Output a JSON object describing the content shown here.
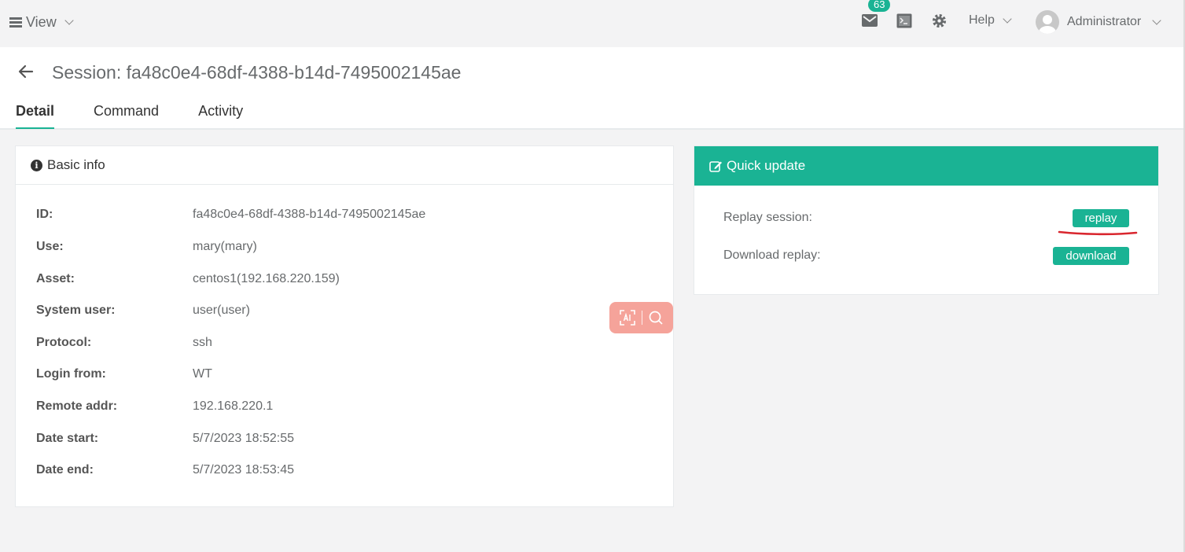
{
  "topbar": {
    "view_label": "View",
    "mail_count": "63",
    "help_label": "Help",
    "user_name": "Administrator"
  },
  "page": {
    "title": "Session: fa48c0e4-68df-4388-b14d-7495002145ae",
    "tabs": [
      {
        "label": "Detail",
        "active": true
      },
      {
        "label": "Command",
        "active": false
      },
      {
        "label": "Activity",
        "active": false
      }
    ]
  },
  "basic_info": {
    "heading": "Basic info",
    "rows": [
      {
        "label": "ID:",
        "value": "fa48c0e4-68df-4388-b14d-7495002145ae"
      },
      {
        "label": "Use:",
        "value": "mary(mary)"
      },
      {
        "label": "Asset:",
        "value": "centos1(192.168.220.159)"
      },
      {
        "label": "System user:",
        "value": "user(user)"
      },
      {
        "label": "Protocol:",
        "value": "ssh"
      },
      {
        "label": "Login from:",
        "value": "WT"
      },
      {
        "label": "Remote addr:",
        "value": "192.168.220.1"
      },
      {
        "label": "Date start:",
        "value": "5/7/2023 18:52:55"
      },
      {
        "label": "Date end:",
        "value": "5/7/2023 18:53:45"
      }
    ]
  },
  "quick_update": {
    "heading": "Quick update",
    "replay_label": "Replay session:",
    "replay_button": "replay",
    "download_label": "Download replay:",
    "download_button": "download"
  },
  "colors": {
    "accent": "#1ab394",
    "annotation": "#d9262e",
    "ai_widget": "#f5a39a"
  },
  "icons": [
    "menu-icon",
    "chevron-down-icon",
    "mail-icon",
    "terminal-icon",
    "gear-icon",
    "user-avatar-icon",
    "back-arrow-icon",
    "info-icon",
    "edit-icon",
    "ai-scan-icon",
    "search-icon"
  ]
}
